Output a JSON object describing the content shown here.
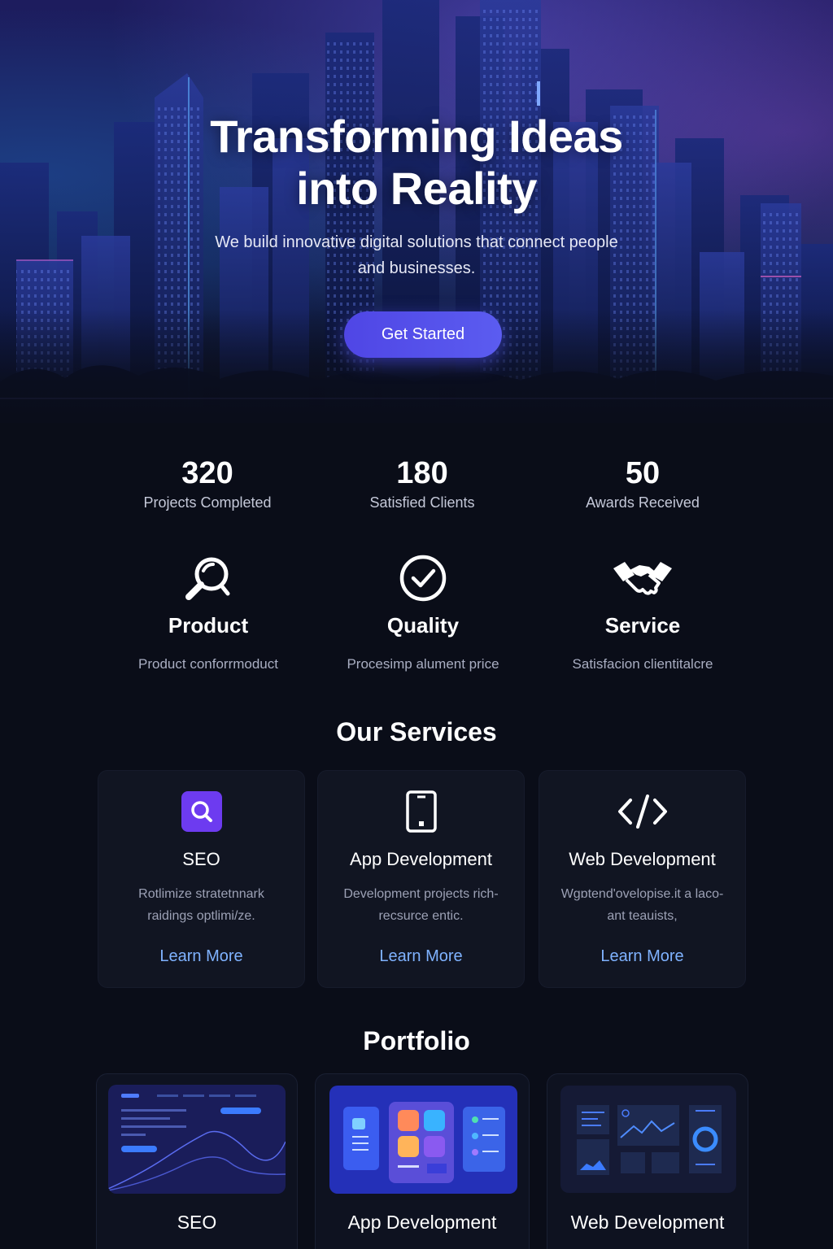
{
  "hero": {
    "title_line1": "Transforming Ideas",
    "title_line2": "into Reality",
    "subtitle": "We build innovative digital solutions that connect people and businesses.",
    "cta_label": "Get Started"
  },
  "stats": [
    {
      "value": "320",
      "label": "Projects Completed"
    },
    {
      "value": "180",
      "label": "Satisfied Clients"
    },
    {
      "value": "50",
      "label": "Awards Received"
    }
  ],
  "features": [
    {
      "icon": "magnifier-icon",
      "title": "Product",
      "description": "Product conforrmoduct"
    },
    {
      "icon": "check-circle-icon",
      "title": "Quality",
      "description": "Procesimp alument price"
    },
    {
      "icon": "handshake-icon",
      "title": "Service",
      "description": "Satisfacion clientitalcre"
    }
  ],
  "services": {
    "heading": "Our Services",
    "items": [
      {
        "icon": "search-icon",
        "title": "SEO",
        "description": "Rotlimize stratetnnark raidings optlimi/ze.",
        "link": "Learn More"
      },
      {
        "icon": "phone-icon",
        "title": "App Development",
        "description": "Development projects rich- recsurce entic.",
        "link": "Learn More"
      },
      {
        "icon": "code-icon",
        "title": "Web Development",
        "description": "Wgɒtend'ovelopise.it a laco-ant teauists,",
        "link": "Learn More"
      }
    ]
  },
  "portfolio": {
    "heading": "Portfolio",
    "items": [
      {
        "title": "SEO",
        "thumbnail": "chart-dashboard-thumbnail"
      },
      {
        "title": "App Development",
        "thumbnail": "mobile-apps-thumbnail"
      },
      {
        "title": "Web Development",
        "thumbnail": "web-dashboard-thumbnail"
      }
    ]
  },
  "colors": {
    "background": "#0a0d18",
    "accent": "#4f46e5",
    "link": "#7fb2ff",
    "card": "#111522"
  }
}
